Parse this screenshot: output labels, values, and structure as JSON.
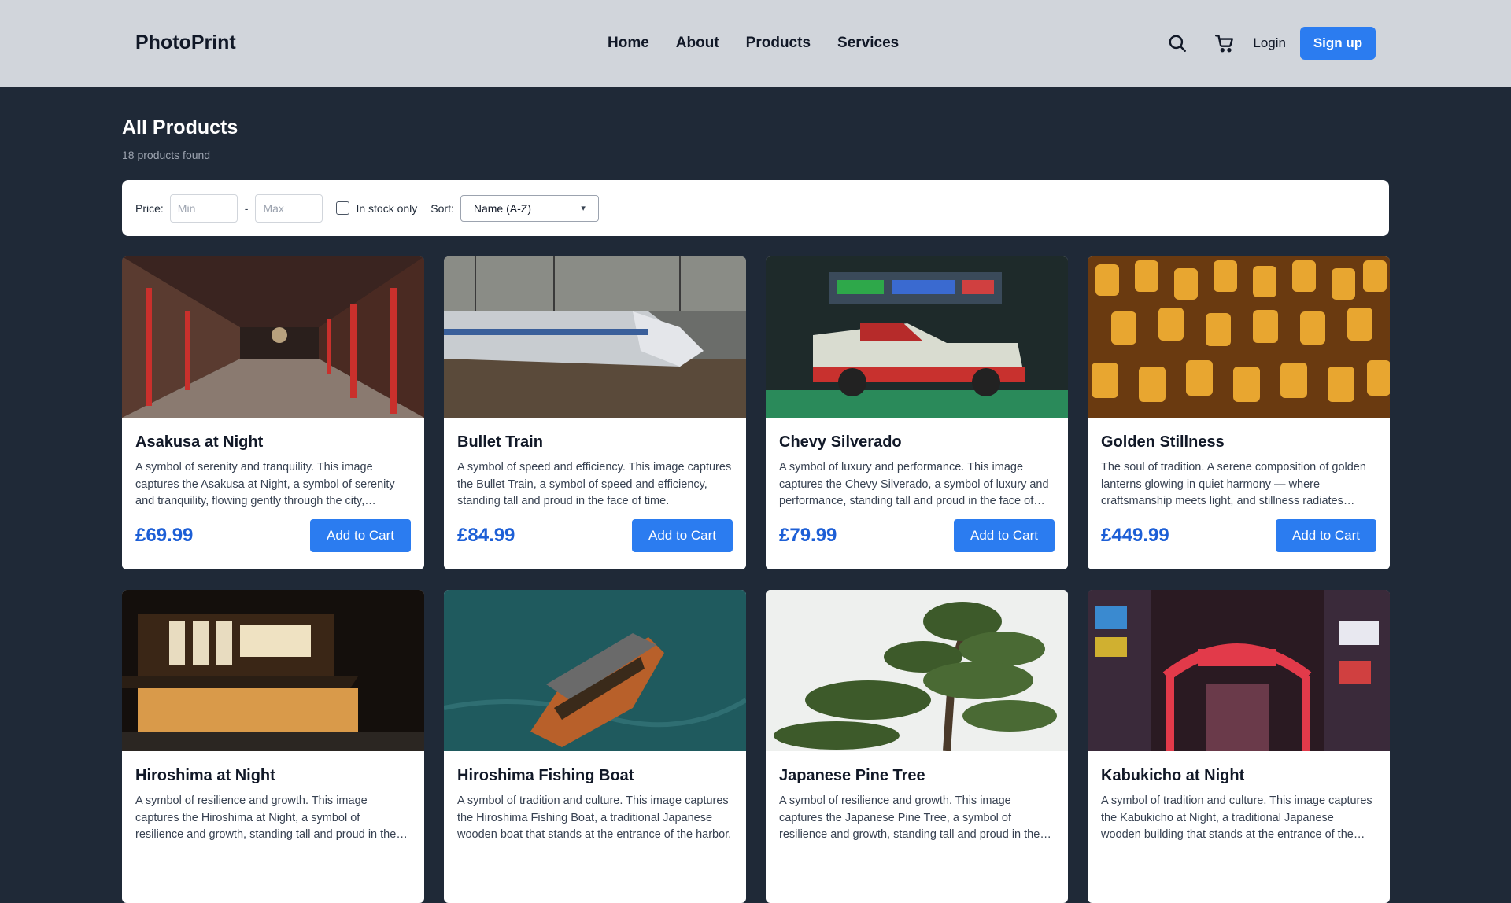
{
  "header": {
    "logo": "PhotoPrint",
    "nav": [
      "Home",
      "About",
      "Products",
      "Services"
    ],
    "login": "Login",
    "signup": "Sign up"
  },
  "page": {
    "title": "All Products",
    "count": "18 products found"
  },
  "filters": {
    "price_label": "Price:",
    "min_placeholder": "Min",
    "max_placeholder": "Max",
    "dash": "-",
    "in_stock_label": "In stock only",
    "in_stock_checked": false,
    "sort_label": "Sort:",
    "sort_selected": "Name (A-Z)"
  },
  "products": [
    {
      "title": "Asakusa at Night",
      "desc": "A symbol of serenity and tranquility. This image captures the Asakusa at Night, a symbol of serenity and tranquility, flowing gently through the city, reflecting the peace of the night.",
      "price": "£69.99",
      "button": "Add to Cart"
    },
    {
      "title": "Bullet Train",
      "desc": "A symbol of speed and efficiency. This image captures the Bullet Train, a symbol of speed and efficiency, standing tall and proud in the face of time.",
      "price": "£84.99",
      "button": "Add to Cart"
    },
    {
      "title": "Chevy Silverado",
      "desc": "A symbol of luxury and performance. This image captures the Chevy Silverado, a symbol of luxury and performance, standing tall and proud in the face of time.",
      "price": "£79.99",
      "button": "Add to Cart"
    },
    {
      "title": "Golden Stillness",
      "desc": "The soul of tradition. A serene composition of golden lanterns glowing in quiet harmony — where craftsmanship meets light, and stillness radiates warmth.",
      "price": "£449.99",
      "button": "Add to Cart"
    },
    {
      "title": "Hiroshima at Night",
      "desc": "A symbol of resilience and growth. This image captures the Hiroshima at Night, a symbol of resilience and growth, standing tall and proud in the face of time.",
      "price": "",
      "button": ""
    },
    {
      "title": "Hiroshima Fishing Boat",
      "desc": "A symbol of tradition and culture. This image captures the Hiroshima Fishing Boat, a traditional Japanese wooden boat that stands at the entrance of the harbor.",
      "price": "",
      "button": ""
    },
    {
      "title": "Japanese Pine Tree",
      "desc": "A symbol of resilience and growth. This image captures the Japanese Pine Tree, a symbol of resilience and growth, standing tall and proud in the face of time.",
      "price": "",
      "button": ""
    },
    {
      "title": "Kabukicho at Night",
      "desc": "A symbol of tradition and culture. This image captures the Kabukicho at Night, a traditional Japanese wooden building that stands at the entrance of the district.",
      "price": "",
      "button": ""
    }
  ],
  "icons": {
    "search": "search-icon",
    "cart": "cart-icon",
    "sort_chevron": "chevron-down-icon"
  },
  "colors": {
    "accent": "#2b7cf0",
    "price": "#1d5fd6",
    "header_bg": "#d1d5db",
    "page_bg": "#1f2937"
  }
}
